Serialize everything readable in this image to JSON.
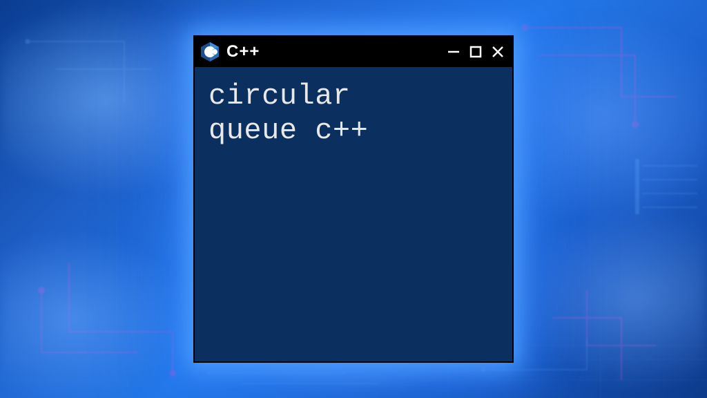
{
  "window": {
    "title": "C++",
    "icon_name": "cpp-logo-icon"
  },
  "content": {
    "text": "circular\nqueue c++"
  },
  "colors": {
    "window_bg": "#0b2f5e",
    "titlebar_bg": "#000000",
    "text": "#e8e8e8",
    "glow": "#4fa0ff"
  }
}
